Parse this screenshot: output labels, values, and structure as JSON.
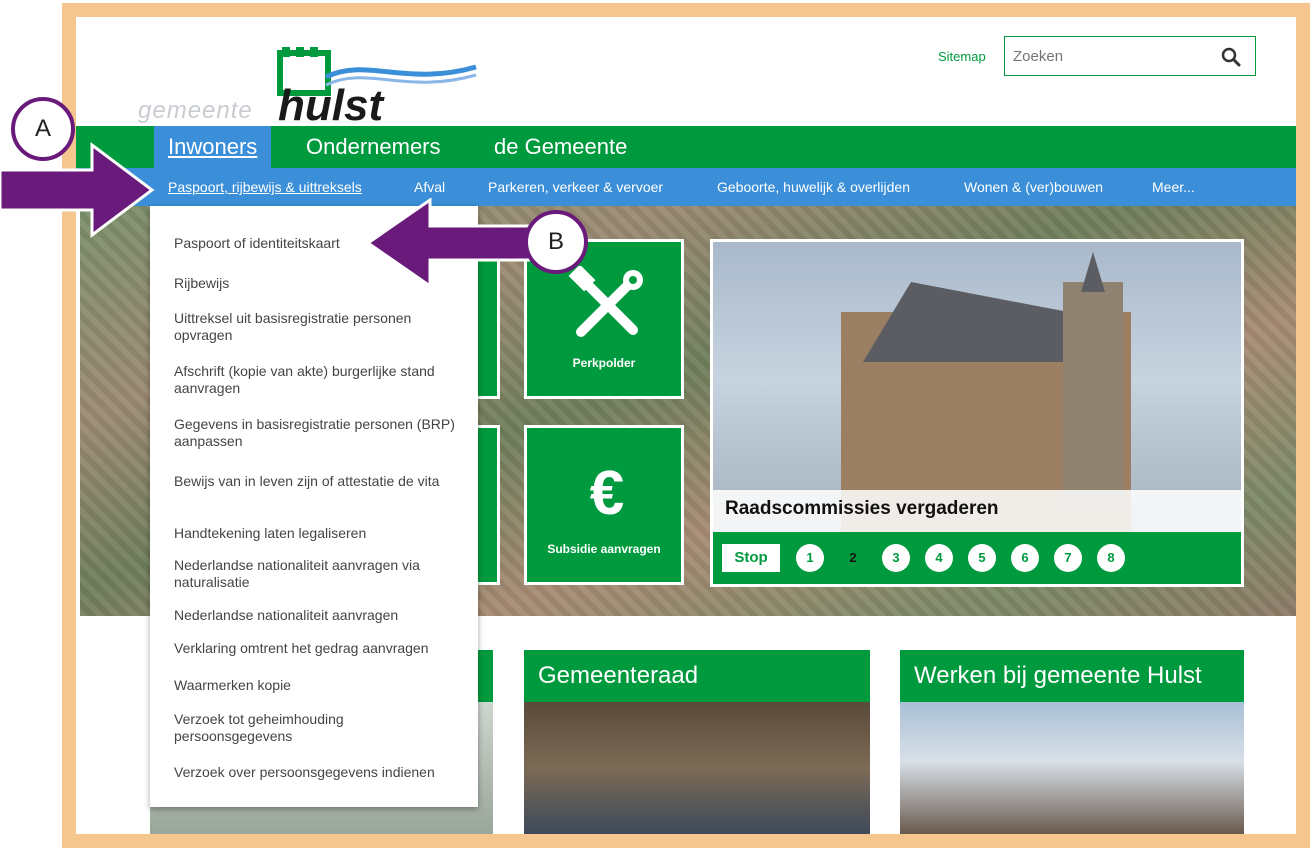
{
  "header": {
    "logo_text_small": "gemeente",
    "logo_text_big": "hulst",
    "sitemap_label": "Sitemap",
    "search_placeholder": "Zoeken"
  },
  "main_nav": {
    "tabs": [
      {
        "label": "Inwoners",
        "active": true
      },
      {
        "label": "Ondernemers",
        "active": false
      },
      {
        "label": "de Gemeente",
        "active": false
      }
    ]
  },
  "sub_nav": {
    "items": [
      {
        "label": "Paspoort, rijbewijs & uittreksels",
        "active": true
      },
      {
        "label": "Afval"
      },
      {
        "label": "Parkeren, verkeer & vervoer"
      },
      {
        "label": "Geboorte, huwelijk & overlijden"
      },
      {
        "label": "Wonen & (ver)bouwen"
      },
      {
        "label": "Meer..."
      }
    ]
  },
  "dropdown": {
    "items": [
      "Paspoort of identiteitskaart",
      "Rijbewijs",
      "Uittreksel uit basisregistratie personen opvragen",
      "Afschrift (kopie van akte) burgerlijke stand aanvragen",
      "Gegevens in basisregistratie personen (BRP) aanpassen",
      "Bewijs van in leven zijn of attestatie de vita",
      "Handtekening laten legaliseren",
      "Nederlandse nationaliteit aanvragen via naturalisatie",
      "Nederlandse nationaliteit aanvragen",
      "Verklaring omtrent het gedrag aanvragen",
      "Waarmerken kopie",
      "Verzoek tot geheimhouding persoonsgegevens",
      "Verzoek over persoonsgegevens indienen"
    ]
  },
  "tiles": [
    {
      "label": "Perkpolder",
      "icon": "tools-icon"
    },
    {
      "label": "Subsidie aanvragen",
      "icon": "euro-icon"
    }
  ],
  "slider": {
    "caption": "Raadscommissies vergaderen",
    "stop_label": "Stop",
    "dots": [
      "1",
      "2",
      "3",
      "4",
      "5",
      "6",
      "7",
      "8"
    ],
    "active_dot": "2"
  },
  "cards": [
    {
      "title": "Gemeenteraad"
    },
    {
      "title": "Werken bij gemeente Hulst"
    }
  ],
  "annotations": {
    "a_label": "A",
    "b_label": "B"
  },
  "colors": {
    "brand_green": "#009a3e",
    "subnav_blue": "#3b8fd8",
    "frame_peach": "#f5c68e",
    "annotation_purple": "#6a1a7a"
  }
}
